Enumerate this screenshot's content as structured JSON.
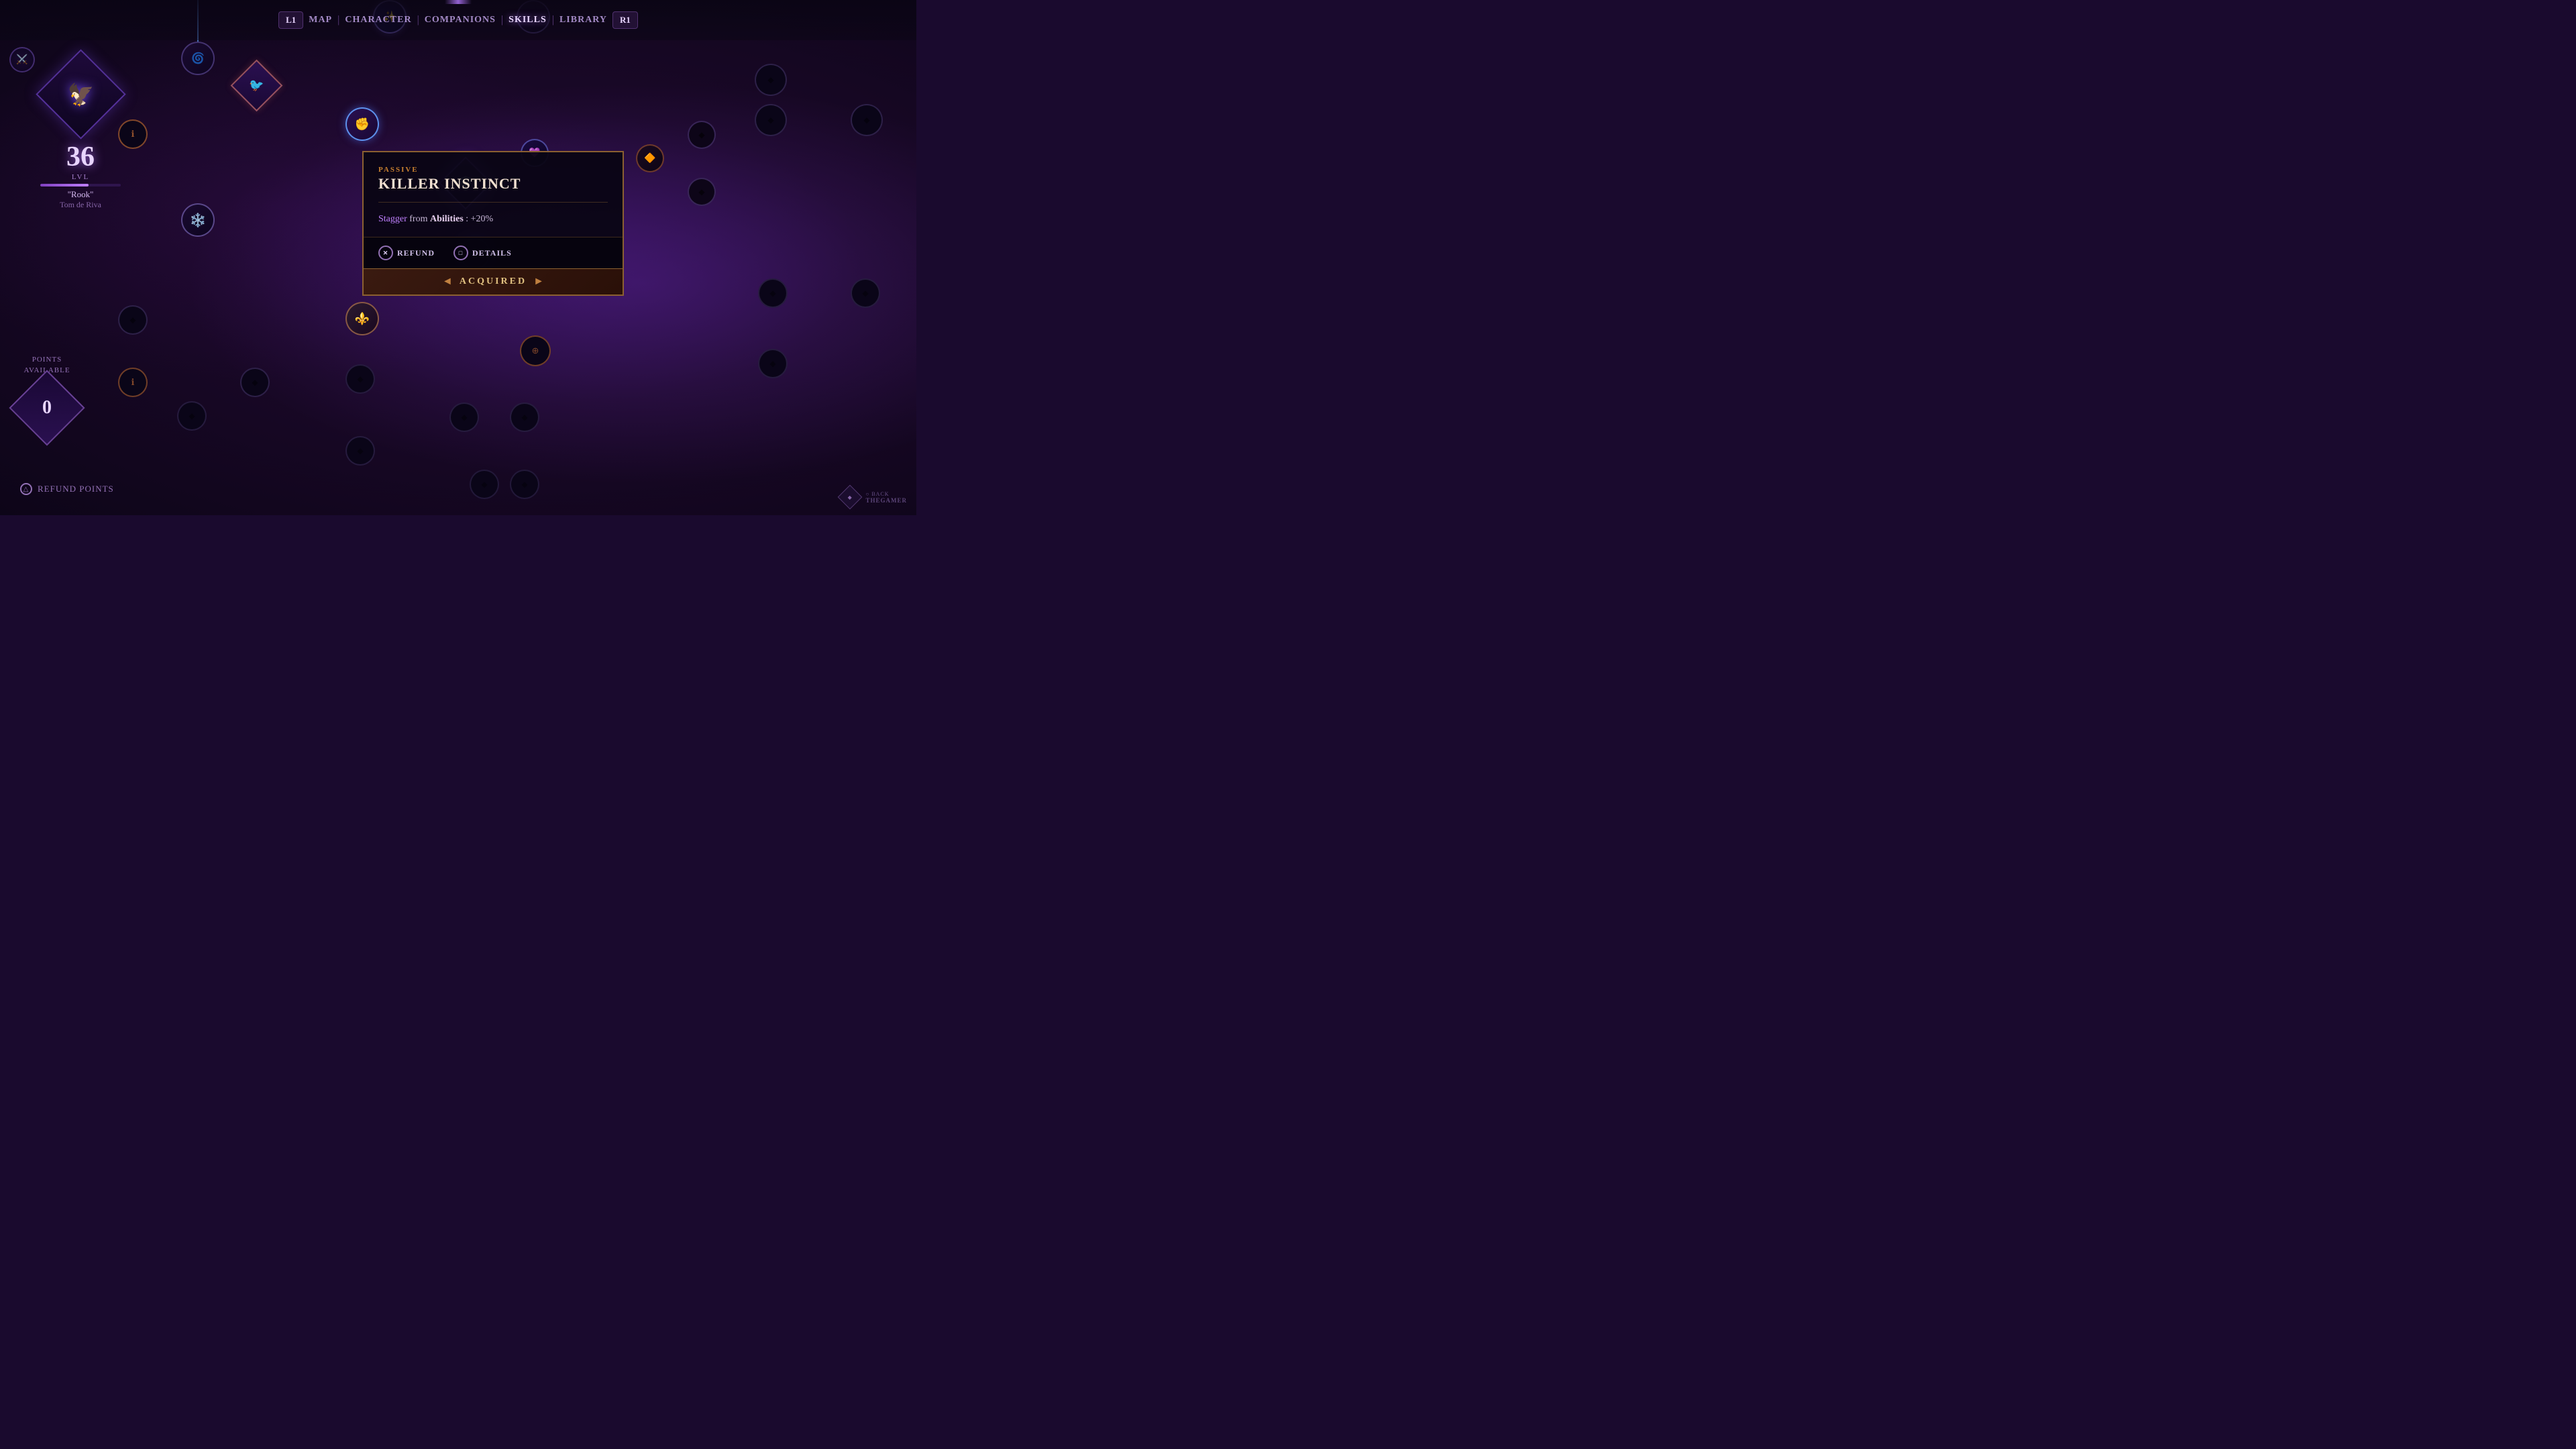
{
  "nav": {
    "left_btn": "L1",
    "right_btn": "R1",
    "items": [
      {
        "id": "map",
        "label": "MAP",
        "active": false
      },
      {
        "id": "character",
        "label": "CHARACTER",
        "active": false
      },
      {
        "id": "companions",
        "label": "COMPANIONS",
        "active": false
      },
      {
        "id": "skills",
        "label": "SKILLS",
        "active": true
      },
      {
        "id": "library",
        "label": "LIBRARY",
        "active": false
      }
    ]
  },
  "character": {
    "level": "36",
    "lvl_label": "LVL",
    "name": "\"Rook\"",
    "subname": "Tom de Riva"
  },
  "points": {
    "label": "POINTS\nAVAILABLE",
    "value": "0"
  },
  "popup": {
    "type": "PASSIVE",
    "title": "KILLER INSTINCT",
    "description_parts": [
      {
        "text": "Stagger",
        "type": "keyword"
      },
      {
        "text": " from ",
        "type": "normal"
      },
      {
        "text": "Abilities",
        "type": "highlight"
      },
      {
        "text": ": +20%",
        "type": "normal"
      }
    ],
    "refund_label": "REFUND",
    "details_label": "DETAILS",
    "acquired_label": "ACQUIRED",
    "refund_btn": "X",
    "details_btn": "□"
  },
  "bottom": {
    "refund_points_label": "REFUND POINTS",
    "back_label": "BACK",
    "back_btn": "○"
  },
  "watermark": {
    "site": "THEGAMER"
  }
}
